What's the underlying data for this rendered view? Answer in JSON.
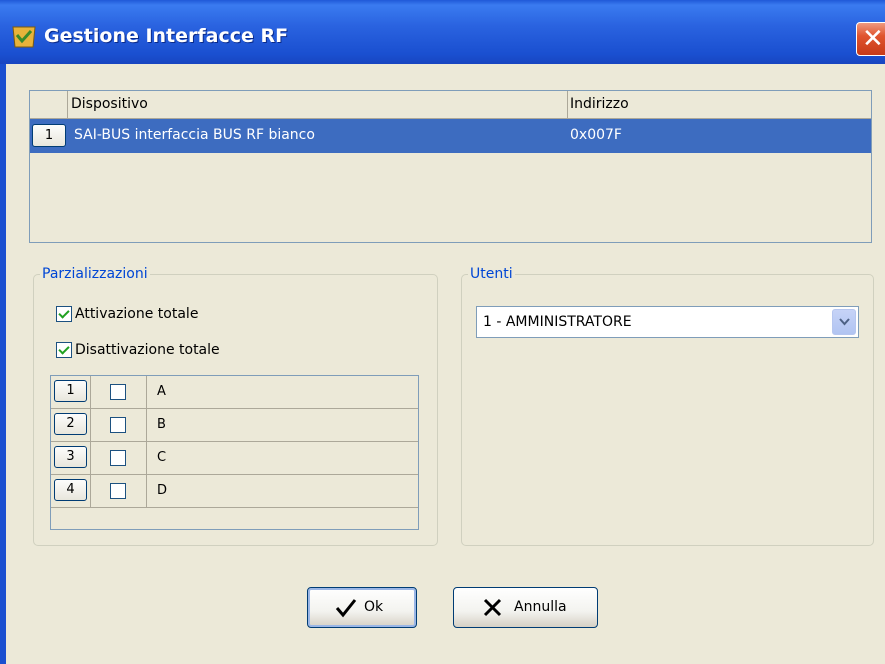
{
  "window": {
    "title": "Gestione Interfacce RF",
    "icons": {
      "app": "check-shield-icon",
      "close": "close-icon"
    },
    "colors": {
      "titlebar": "#2a63e0",
      "selection": "#3d6cc0",
      "group_label": "#0046d5",
      "close": "#e0552f"
    }
  },
  "devices": {
    "columns": [
      "Dispositivo",
      "Indirizzo"
    ],
    "rows": [
      {
        "num": "1",
        "name": "SAI-BUS interfaccia BUS RF bianco",
        "address": "0x007F",
        "selected": true
      }
    ]
  },
  "parzializzazioni": {
    "label": "Parzializzazioni",
    "options": [
      {
        "label": "Attivazione totale",
        "checked": true
      },
      {
        "label": "Disattivazione totale",
        "checked": true
      }
    ],
    "zones": [
      {
        "num": "1",
        "checked": false,
        "name": "A"
      },
      {
        "num": "2",
        "checked": false,
        "name": "B"
      },
      {
        "num": "3",
        "checked": false,
        "name": "C"
      },
      {
        "num": "4",
        "checked": false,
        "name": "D"
      }
    ]
  },
  "utenti": {
    "label": "Utenti",
    "selected": "1 - AMMINISTRATORE"
  },
  "buttons": {
    "ok": {
      "label": "Ok",
      "icon": "checkmark-icon"
    },
    "cancel": {
      "label": "Annulla",
      "icon": "x-icon"
    }
  }
}
